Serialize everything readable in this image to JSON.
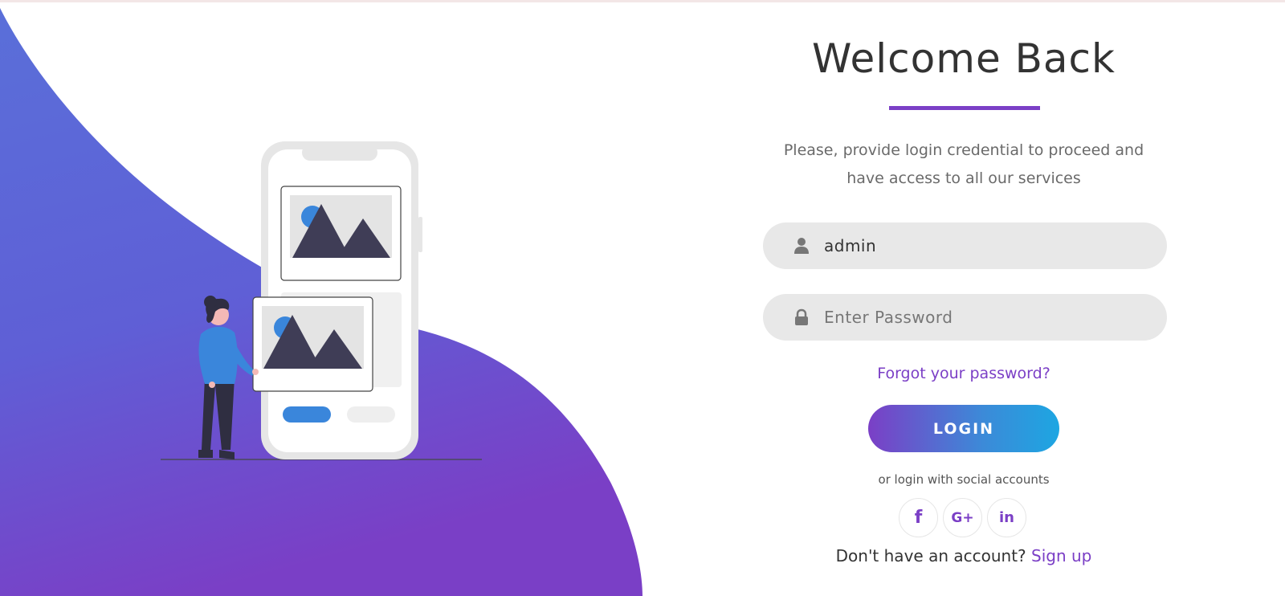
{
  "login": {
    "title": "Welcome Back",
    "subtitle_line1": "Please, provide login credential to proceed and",
    "subtitle_line2": "have access to all our services",
    "username": {
      "value": "admin",
      "icon": "user-icon"
    },
    "password": {
      "placeholder": "Enter Password",
      "icon": "lock-icon"
    },
    "forgot_link": "Forgot your password?",
    "login_button": "LOGIN",
    "social_text": "or login with social accounts",
    "social": [
      {
        "label": "f",
        "icon": "facebook-icon"
      },
      {
        "label": "G+",
        "icon": "google-plus-icon"
      },
      {
        "label": "in",
        "icon": "linkedin-icon"
      }
    ],
    "signup_prompt": "Don't have an account?",
    "signup_link": "Sign up"
  },
  "colors": {
    "accent": "#7b3fc6",
    "gradient_start": "#7b3fc6",
    "gradient_end": "#1da6e2",
    "blob_top": "#5a67d8",
    "blob_bottom": "#7b3fc6",
    "field_bg": "#e8e8e8"
  }
}
